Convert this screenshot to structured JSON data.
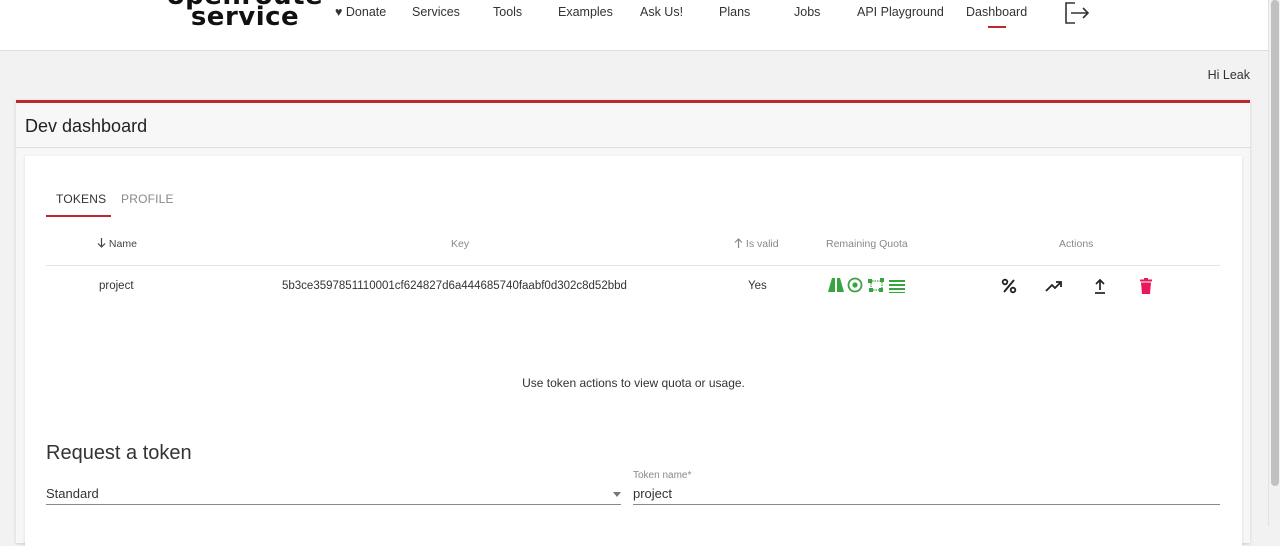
{
  "logo": {
    "line1": "openroute",
    "line2": "service"
  },
  "nav": [
    {
      "label": "♥ Donate"
    },
    {
      "label": "Services"
    },
    {
      "label": "Tools"
    },
    {
      "label": "Examples"
    },
    {
      "label": "Ask Us!"
    },
    {
      "label": "Plans"
    },
    {
      "label": "Jobs"
    },
    {
      "label": "API Playground"
    },
    {
      "label": "Dashboard",
      "active": true
    }
  ],
  "greeting": "Hi Leak",
  "panel": {
    "title": "Dev dashboard"
  },
  "tabs": [
    {
      "label": "TOKENS",
      "active": true
    },
    {
      "label": "PROFILE"
    }
  ],
  "table": {
    "headers": {
      "name": "Name",
      "name_sort_icon": "arrow-down-icon",
      "key": "Key",
      "is_valid": "Is valid",
      "is_valid_sort_icon": "arrow-up-icon",
      "remaining_quota": "Remaining Quota",
      "actions": "Actions"
    },
    "rows": [
      {
        "name": "project",
        "key": "5b3ce3597851110001cf624827d6a444685740faabf0d302c8d52bbd",
        "is_valid": "Yes",
        "quota_icons": [
          "road-icon",
          "target-icon",
          "matrix-icon",
          "list-icon"
        ],
        "actions": [
          "percent-icon",
          "trending-up-icon",
          "upload-icon",
          "trash-icon"
        ]
      }
    ]
  },
  "message": "Use token actions to view quota or usage.",
  "request": {
    "title": "Request a token",
    "type_value": "Standard",
    "token_name_label": "Token name*",
    "token_name_value": "project"
  },
  "colors": {
    "accent": "#c0262c",
    "quota_green": "#3aa341",
    "delete_pink": "#e8185a"
  }
}
